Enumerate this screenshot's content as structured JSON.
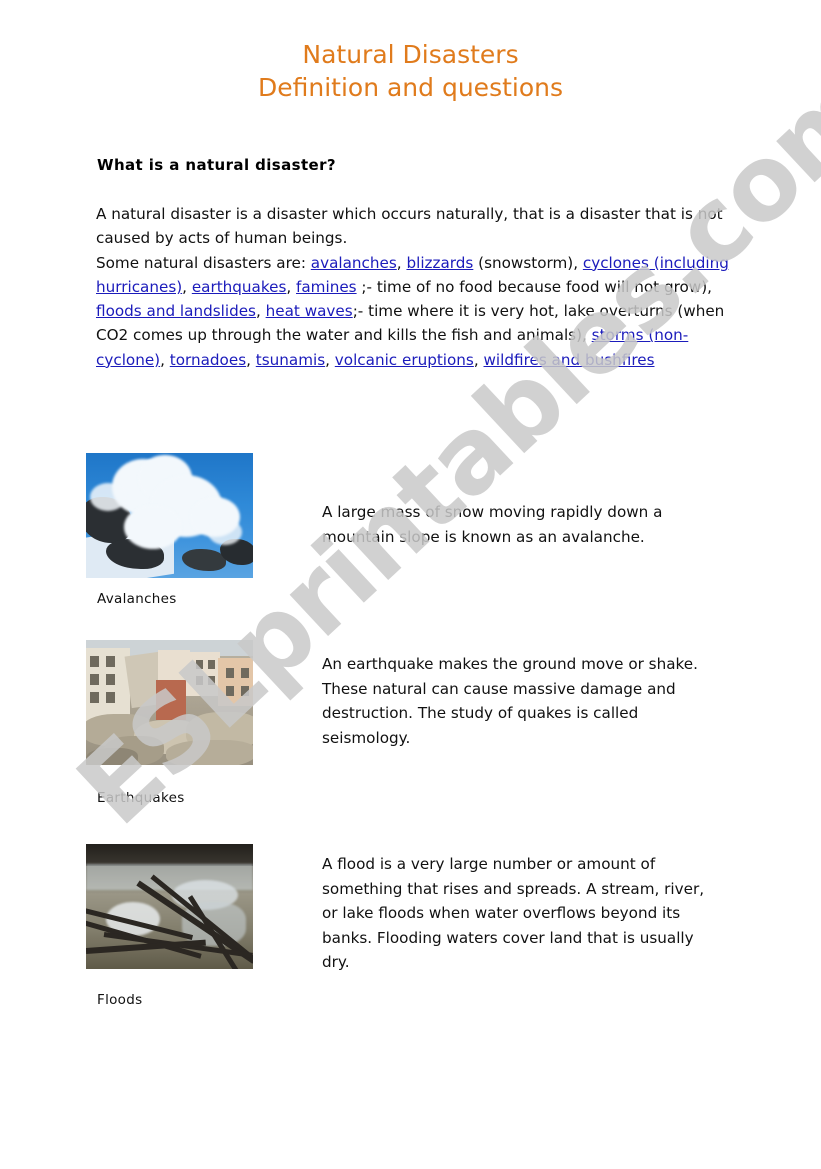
{
  "document": {
    "title_line_1": "Natural Disasters",
    "title_line_2": "Definition and questions",
    "title_color": "#e07b1c",
    "link_color": "#1b1bbb",
    "background_color": "#ffffff",
    "watermark_text": "ESLprintables.com",
    "watermark_color": "#c9c9c9"
  },
  "section": {
    "heading": "What is a natural disaster?",
    "paragraph": {
      "sentence_1": "A natural disaster is a disaster which occurs naturally, that is a disaster that is not caused by acts of human beings.",
      "lead_in": "Some natural disasters are:",
      "links": [
        "avalanches",
        "blizzards",
        "cyclones (including hurricanes)",
        "earthquakes",
        "famines",
        "floods and landslides",
        "heat waves",
        "storms (non-cyclone)",
        "tornadoes",
        "tsunamis",
        "volcanic eruptions",
        "wildfires and bushfires"
      ],
      "note_blizzards": "(snowstorm),",
      "note_famines": ";- time of no food because food will not grow),",
      "note_heat_waves": ";- time where it is very hot, lake overturns (when CO2 comes up through the water and kills the fish and animals),"
    }
  },
  "entries": [
    {
      "caption": "Avalanches",
      "image_name": "avalanche-photo",
      "description": "A large mass of snow moving rapidly down a mountain slope is known as an avalanche."
    },
    {
      "caption": "Earthquakes",
      "image_name": "earthquake-photo",
      "description": "An earthquake makes the ground move or shake. These natural can cause massive damage and destruction. The study of quakes is called seismology."
    },
    {
      "caption": "Floods",
      "image_name": "flood-photo",
      "description": "A flood is a very large number or amount of something that rises and spreads. A stream, river, or lake floods when water overflows beyond its banks. Flooding waters cover land that is usually dry."
    }
  ]
}
